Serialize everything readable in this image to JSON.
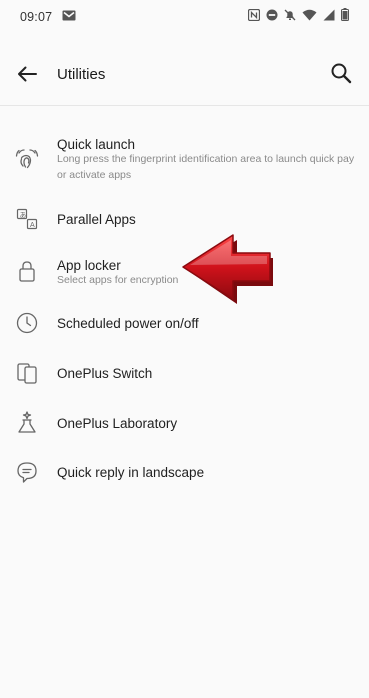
{
  "status_bar": {
    "time": "09:07",
    "icons": [
      "gmail-icon",
      "nfc-icon",
      "do-not-disturb-icon",
      "mute-icon",
      "wifi-icon",
      "signal-icon",
      "battery-icon"
    ]
  },
  "app_bar": {
    "title": "Utilities"
  },
  "items": [
    {
      "title": "Quick launch",
      "subtitle": "Long press the fingerprint identification area to launch quick pay or activate apps",
      "icon": "quick-launch-icon"
    },
    {
      "title": "Parallel Apps",
      "icon": "parallel-apps-icon"
    },
    {
      "title": "App locker",
      "subtitle": "Select apps for encryption",
      "icon": "lock-icon"
    },
    {
      "title": "Scheduled power on/off",
      "icon": "clock-icon"
    },
    {
      "title": "OnePlus Switch",
      "icon": "phone-switch-icon"
    },
    {
      "title": "OnePlus Laboratory",
      "icon": "flask-icon"
    },
    {
      "title": "Quick reply in landscape",
      "icon": "chat-bubble-icon"
    }
  ],
  "colors": {
    "background": "#fafafa",
    "icon": "#666666",
    "annotation_arrow": "#d0121b"
  }
}
